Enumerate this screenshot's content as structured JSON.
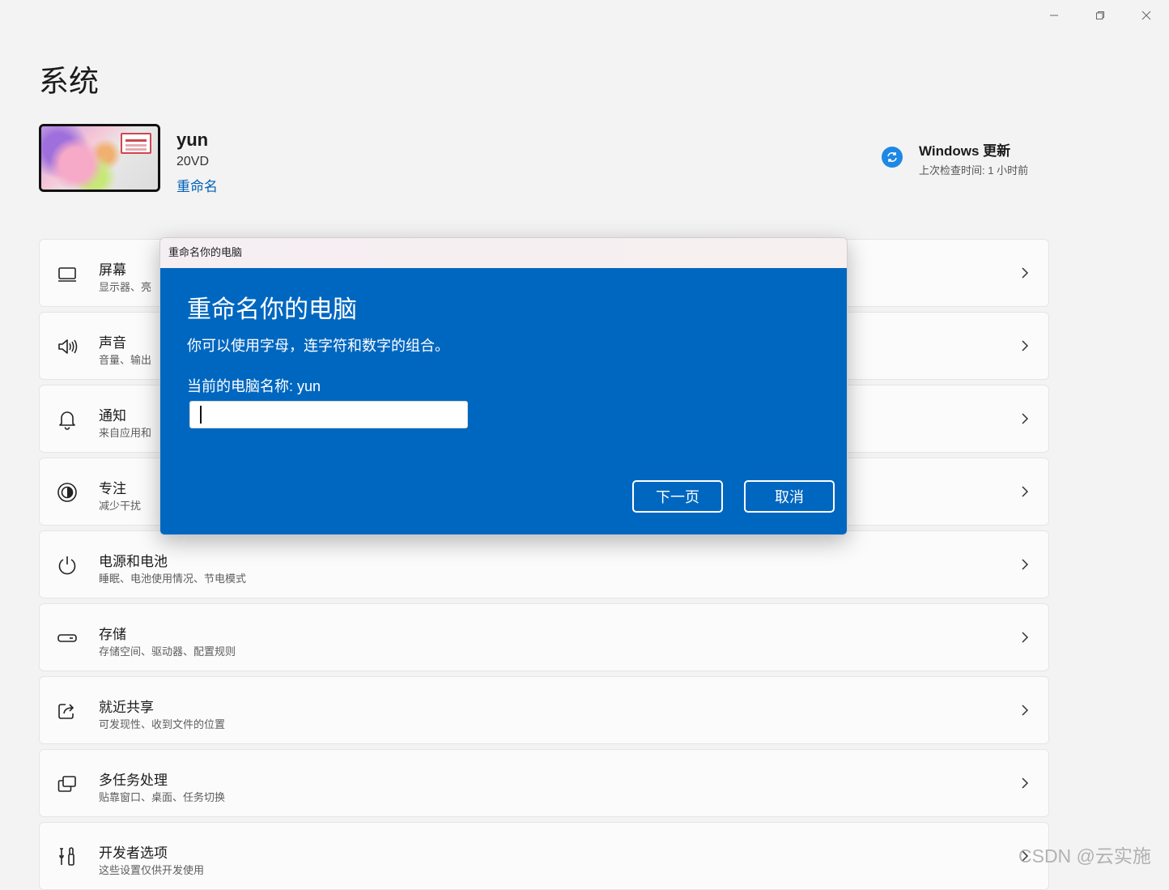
{
  "window": {
    "controls": [
      "minimize",
      "restore",
      "close"
    ]
  },
  "page": {
    "title": "系统"
  },
  "device": {
    "name": "yun",
    "model": "20VD",
    "rename": "重命名"
  },
  "update": {
    "title": "Windows 更新",
    "subtitle": "上次检查时间: 1 小时前"
  },
  "settings": [
    {
      "title": "屏幕",
      "desc": "显示器、亮",
      "icon": "monitor-icon"
    },
    {
      "title": "声音",
      "desc": "音量、输出",
      "icon": "speaker-icon"
    },
    {
      "title": "通知",
      "desc": "来自应用和",
      "icon": "bell-icon"
    },
    {
      "title": "专注",
      "desc": "减少干扰",
      "icon": "focus-icon"
    },
    {
      "title": "电源和电池",
      "desc": "睡眠、电池使用情况、节电模式",
      "icon": "power-icon"
    },
    {
      "title": "存储",
      "desc": "存储空间、驱动器、配置规则",
      "icon": "storage-icon"
    },
    {
      "title": "就近共享",
      "desc": "可发现性、收到文件的位置",
      "icon": "share-icon"
    },
    {
      "title": "多任务处理",
      "desc": "贴靠窗口、桌面、任务切换",
      "icon": "multitask-icon"
    },
    {
      "title": "开发者选项",
      "desc": "这些设置仅供开发使用",
      "icon": "developer-icon"
    }
  ],
  "dialog": {
    "bar_title": "重命名你的电脑",
    "heading": "重命名你的电脑",
    "description": "你可以使用字母，连字符和数字的组合。",
    "current_name": "当前的电脑名称: yun",
    "input_value": "",
    "next_label": "下一页",
    "cancel_label": "取消"
  },
  "watermark": "CSDN @云实施",
  "colors": {
    "dialog_bg": "#0067c0",
    "link": "#0060b8",
    "update_icon": "#1e88e5"
  }
}
